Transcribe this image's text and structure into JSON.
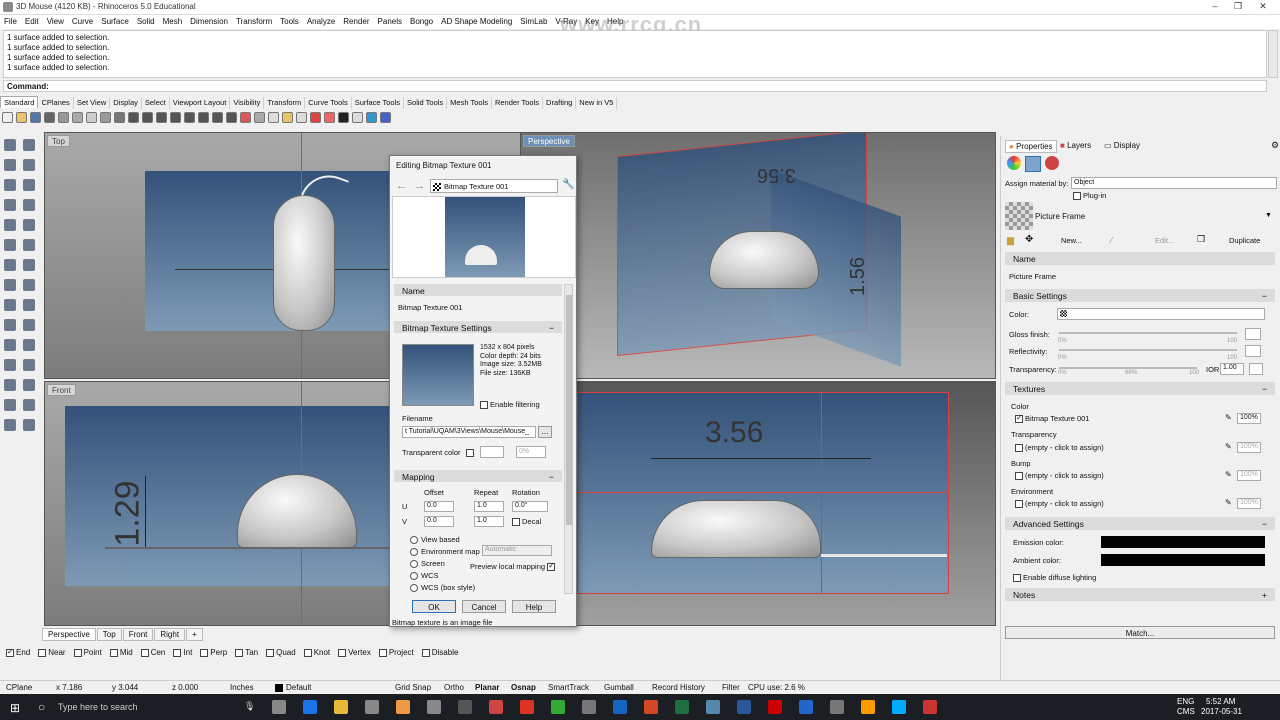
{
  "window": {
    "title": "3D Mouse (4120 KB) - Rhinoceros 5.0 Educational"
  },
  "watermark": "www.rrcg.cn",
  "menu": [
    "File",
    "Edit",
    "View",
    "Curve",
    "Surface",
    "Solid",
    "Mesh",
    "Dimension",
    "Transform",
    "Tools",
    "Analyze",
    "Render",
    "Panels",
    "Bongo",
    "AD Shape Modeling",
    "SimLab",
    "V-Ray",
    "Key",
    "Help"
  ],
  "history": [
    "1 surface added to selection.",
    "1 surface added to selection.",
    "1 surface added to selection.",
    "1 surface added to selection."
  ],
  "command_label": "Command:",
  "tabs": [
    "Standard",
    "CPlanes",
    "Set View",
    "Display",
    "Select",
    "Viewport Layout",
    "Visibility",
    "Transform",
    "Curve Tools",
    "Surface Tools",
    "Solid Tools",
    "Mesh Tools",
    "Render Tools",
    "Drafting",
    "New in V5"
  ],
  "viewports": {
    "top": "Top",
    "front": "Front",
    "perspective": "Perspective",
    "right": ""
  },
  "dims": {
    "front_height": "1.29",
    "right_width": "3.56",
    "persp_a": "3.56",
    "persp_b": "1.56"
  },
  "viewport_tabs": [
    "Perspective",
    "Top",
    "Front",
    "Right",
    "+"
  ],
  "osnaps": [
    {
      "label": "End",
      "on": true
    },
    {
      "label": "Near",
      "on": false
    },
    {
      "label": "Point",
      "on": false
    },
    {
      "label": "Mid",
      "on": false
    },
    {
      "label": "Cen",
      "on": false
    },
    {
      "label": "Int",
      "on": false
    },
    {
      "label": "Perp",
      "on": false
    },
    {
      "label": "Tan",
      "on": false
    },
    {
      "label": "Quad",
      "on": false
    },
    {
      "label": "Knot",
      "on": false
    },
    {
      "label": "Vertex",
      "on": false
    },
    {
      "label": "Project",
      "on": false
    },
    {
      "label": "Disable",
      "on": false
    }
  ],
  "status": {
    "cplane": "CPlane",
    "x": "x 7.186",
    "y": "y 3.044",
    "z": "z 0.000",
    "units": "Inches",
    "layer": "Default",
    "grid_snap": "Grid Snap",
    "ortho": "Ortho",
    "planar": "Planar",
    "osnap": "Osnap",
    "smarttrack": "SmartTrack",
    "gumball": "Gumball",
    "record_history": "Record History",
    "filter": "Filter",
    "cpu": "CPU use: 2.6 %"
  },
  "taskbar": {
    "search": "Type here to search",
    "lang": "ENG",
    "ime": "CMS",
    "time": "5:52 AM",
    "date": "2017-05-31"
  },
  "dialog": {
    "title": "Editing Bitmap Texture 001",
    "nav_label": "Bitmap Texture 001",
    "name_header": "Name",
    "name_value": "Bitmap Texture 001",
    "settings_header": "Bitmap Texture Settings",
    "info": [
      "1532 x 804 pixels",
      "Color depth: 24 bits",
      "Image size: 3.52MB",
      "File size: 136KB"
    ],
    "enable_filtering": "Enable filtering",
    "filename_label": "Filename",
    "filename_value": "t Tutorial\\UQAM\\3Views\\Mouse\\Mouse_",
    "browse": "...",
    "transparent_color": "Transparent color",
    "transparent_pct": "0%",
    "mapping_header": "Mapping",
    "col_offset": "Offset",
    "col_repeat": "Repeat",
    "col_rotation": "Rotation",
    "u": "U",
    "v": "V",
    "u_offset": "0.0",
    "u_repeat": "1.0",
    "rotation": "0.0°",
    "v_offset": "0.0",
    "v_repeat": "1.0",
    "decal": "Decal",
    "radios": [
      "View based",
      "Environment map",
      "Screen",
      "WCS",
      "WCS (box style)"
    ],
    "env_select": "Automatic",
    "preview_local": "Preview local mapping",
    "ok": "OK",
    "cancel": "Cancel",
    "help": "Help",
    "status": "Bitmap texture is an image file"
  },
  "panel": {
    "tabs": [
      "Properties",
      "Layers",
      "Display"
    ],
    "assign_label": "Assign material by:",
    "assign_value": "Object",
    "plugin": "Plug-in",
    "material_name": "Picture Frame",
    "new_btn": "New...",
    "edit_btn": "Edit...",
    "duplicate_btn": "Duplicate",
    "name_header": "Name",
    "name_value": "Picture Frame",
    "basic_header": "Basic Settings",
    "color_label": "Color:",
    "gloss_label": "Gloss finish:",
    "reflect_label": "Reflectivity:",
    "transp_label": "Transparency:",
    "ior_label": "IOR:",
    "ior_value": "1.00",
    "pct0": "0%",
    "pct100": "100",
    "pct_mid": "68%",
    "textures_header": "Textures",
    "tx_color": "Color",
    "tx_color_value": "Bitmap Texture 001",
    "tx_transp": "Transparency",
    "tx_bump": "Bump",
    "tx_env": "Environment",
    "tx_empty": "(empty - click to assign)",
    "tx_pct": "100%",
    "advanced_header": "Advanced Settings",
    "emission": "Emission color:",
    "ambient": "Ambient color:",
    "diffuse": "Enable diffuse lighting",
    "notes_header": "Notes",
    "match_btn": "Match..."
  },
  "colors": {
    "accent": "#2f6db5",
    "redline": "#d8403c",
    "blueplane": "#34527a"
  }
}
